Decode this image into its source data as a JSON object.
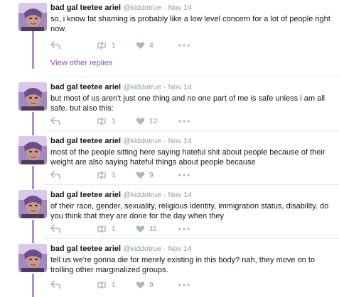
{
  "colors": {
    "thread_line": "#b18fcf",
    "link": "#8a4fc4",
    "muted": "#8899a6"
  },
  "view_other_replies": "View other replies",
  "tweets": [
    {
      "name": "bad gal teetee ariel",
      "handle": "@kiddotrue",
      "dot": "·",
      "time": "Nov 14",
      "text": "so, i know fat shaming is probably like a low level concern for a lot of people right now.",
      "retweets": "1",
      "likes": "4"
    },
    {
      "name": "bad gal teetee ariel",
      "handle": "@kiddotrue",
      "dot": "·",
      "time": "Nov 14",
      "text": "but most of us aren't just one thing and no one part of me is safe unless i am all safe. but also this:",
      "retweets": "1",
      "likes": "12"
    },
    {
      "name": "bad gal teetee ariel",
      "handle": "@kiddotrue",
      "dot": "·",
      "time": "Nov 14",
      "text": "most of the people sitting here saying hateful shit about people because of their weight are also saying hateful things about people because",
      "retweets": "1",
      "likes": "9"
    },
    {
      "name": "bad gal teetee ariel",
      "handle": "@kiddotrue",
      "dot": "·",
      "time": "Nov 14",
      "text": "of their race, gender, sexuality, religious identity, immigration status, disability. do you think that they are done for the day when they",
      "retweets": "1",
      "likes": "11"
    },
    {
      "name": "bad gal teetee ariel",
      "handle": "@kiddotrue",
      "dot": "·",
      "time": "Nov 14",
      "text": "tell us we're gonna die for merely existing in this body? nah, they move on to trolling other marginalized groups.",
      "retweets": "1",
      "likes": "9"
    }
  ]
}
